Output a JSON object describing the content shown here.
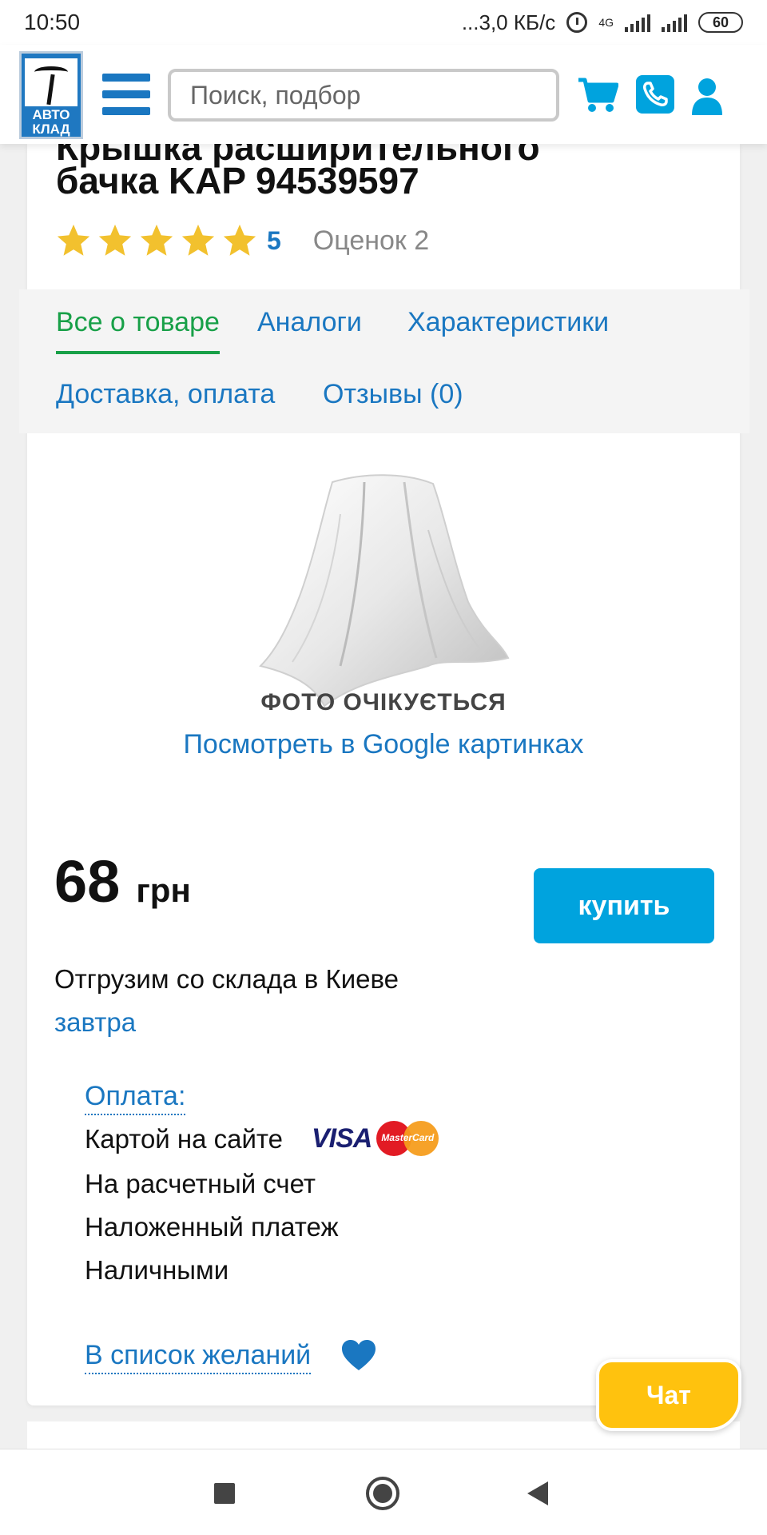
{
  "status_bar": {
    "time": "10:50",
    "network_speed": "...3,0 КБ/с",
    "network_type": "4G",
    "battery": "60"
  },
  "header": {
    "logo_line1": "АВТО",
    "logo_line2": "КЛАД",
    "search_placeholder": "Поиск, подбор",
    "icons": [
      "menu-icon",
      "cart-icon",
      "phone-icon",
      "user-icon"
    ],
    "accent_color": "#00a3de"
  },
  "product": {
    "title_line1": "Крышка расширительного",
    "title_line2": "бачка KAP 94539597",
    "rating_stars": 5,
    "rating_value": "5",
    "rating_count": "Оценок 2"
  },
  "tabs": [
    {
      "label": "Все о товаре",
      "active": true
    },
    {
      "label": "Аналоги",
      "active": false
    },
    {
      "label": "Характеристики",
      "active": false
    },
    {
      "label": "Доставка, оплата",
      "active": false
    },
    {
      "label": "Отзывы (0)",
      "active": false
    }
  ],
  "photo": {
    "placeholder_text": "ФОТО ОЧІКУЄТЬСЯ",
    "google_link": "Посмотреть в Google картинках"
  },
  "price": {
    "value": "68",
    "currency": "грн",
    "buy_label": "купить",
    "shipping": "Отгрузим со склада в Киеве",
    "shipping_when": "завтра"
  },
  "payment": {
    "title": "Оплата:",
    "methods": [
      "Картой на сайте",
      "На расчетный счет",
      "Наложенный платеж",
      "Наличными"
    ],
    "visa_label": "VISA",
    "mastercard_label": "MasterCard"
  },
  "wishlist_label": "В список желаний",
  "chat_label": "Чат"
}
